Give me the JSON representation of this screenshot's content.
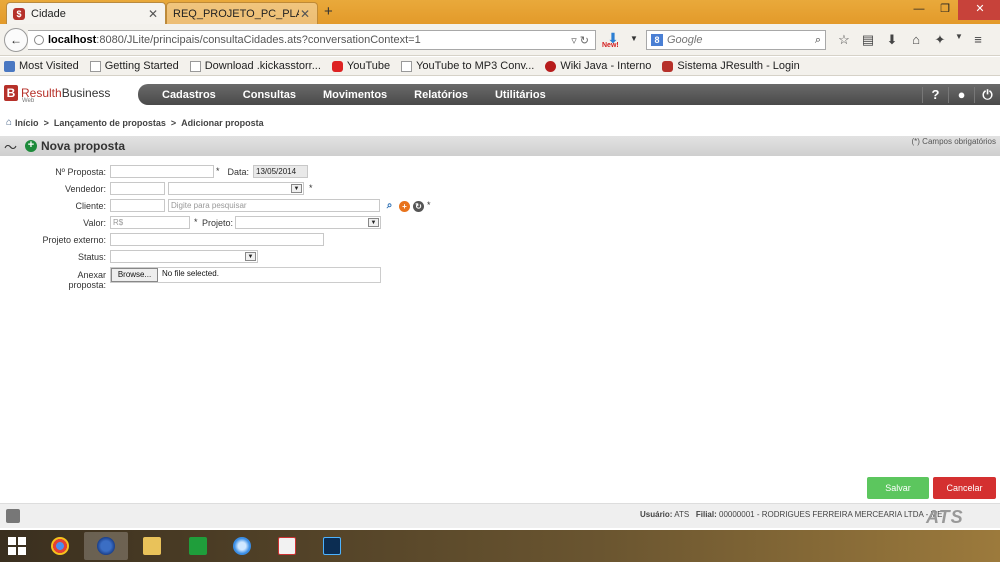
{
  "browser": {
    "tabs": [
      {
        "title": "Cidade",
        "active": true
      },
      {
        "title": "REQ_PROJETO_PC_PLACE - RE...",
        "active": false
      }
    ],
    "url": {
      "host": "localhost",
      "rest": ":8080/JLite/principais/consultaCidades.ats?conversationContext=1"
    },
    "download_badge": "New!",
    "search_placeholder": "Google",
    "search_engine_icon": "google-icon",
    "toolbar_icons": [
      "star-icon",
      "bookmarks-icon",
      "download-icon",
      "home-icon",
      "addon-icon",
      "menu-icon"
    ],
    "bookmarks": [
      {
        "label": "Most Visited",
        "icon": "most-visited-icon"
      },
      {
        "label": "Getting Started",
        "icon": "page-icon"
      },
      {
        "label": "Download .kickasstorr...",
        "icon": "page-icon"
      },
      {
        "label": "YouTube",
        "icon": "youtube-icon"
      },
      {
        "label": "YouTube to MP3 Conv...",
        "icon": "page-icon"
      },
      {
        "label": "Wiki Java - Interno",
        "icon": "wiki-icon"
      },
      {
        "label": "Sistema JResulth - Login",
        "icon": "jresulth-icon"
      }
    ]
  },
  "app": {
    "logo": {
      "letter": "B",
      "brand_a": "Resulth",
      "brand_b": "Business",
      "sub": "Web"
    },
    "menu": [
      "Cadastros",
      "Consultas",
      "Movimentos",
      "Relatórios",
      "Utilitários"
    ],
    "header_icons": [
      "help-icon",
      "user-icon",
      "power-icon"
    ],
    "breadcrumb": [
      "Início",
      "Lançamento de propostas",
      "Adicionar proposta"
    ],
    "page_title": "Nova proposta",
    "required_note": "(*) Campos obrigatórios",
    "form": {
      "numero_label": "Nº Proposta:",
      "numero_value": "",
      "data_label": "Data:",
      "data_value": "13/05/2014",
      "vendedor_label": "Vendedor:",
      "vendedor_code": "",
      "cliente_label": "Cliente:",
      "cliente_code": "",
      "cliente_placeholder": "Digite para pesquisar",
      "valor_label": "Valor:",
      "valor_placeholder": "R$",
      "projeto_label": "Projeto:",
      "projeto_externo_label": "Projeto externo:",
      "status_label": "Status:",
      "anexar_label": "Anexar proposta:",
      "browse_label": "Browse...",
      "no_file": "No file selected.",
      "required_mark": "*"
    },
    "buttons": {
      "salvar": "Salvar",
      "cancelar": "Cancelar"
    },
    "footer": {
      "user_label": "Usuário:",
      "user_value": "ATS",
      "filial_label": "Filial:",
      "filial_value": "00000001 - RODRIGUES FERREIRA MERCEARIA LTDA - ME",
      "brand": "ATS"
    }
  },
  "colors": {
    "accent_red": "#b6312a",
    "save_green": "#5cc65e",
    "cancel_red": "#d43030",
    "menu_dark": "#555555"
  },
  "taskbar": {
    "apps": [
      "chrome-icon",
      "firefox-icon",
      "explorer-icon",
      "store-icon",
      "itunes-icon",
      "java-icon",
      "photoshop-icon"
    ]
  }
}
